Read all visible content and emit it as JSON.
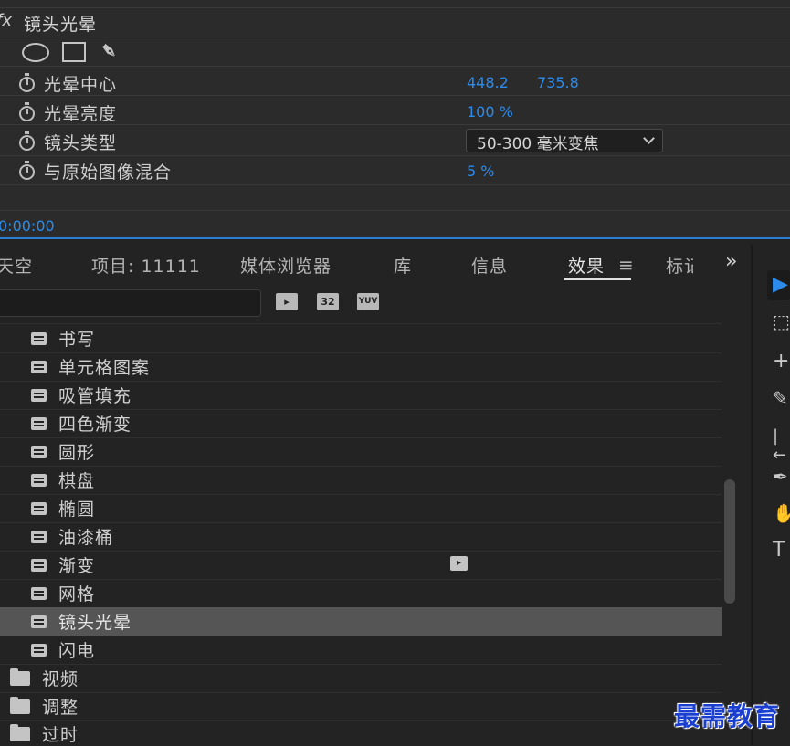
{
  "effect_controls": {
    "fx_badge": "fx",
    "effect_name": "镜头光晕",
    "mask_tools": [
      "ellipse-mask-icon",
      "rectangle-mask-icon",
      "pen-mask-icon"
    ],
    "params": [
      {
        "label": "光晕中心",
        "value_x": "448.2",
        "value_y": "735.8"
      },
      {
        "label": "光晕亮度",
        "value": "100 %"
      },
      {
        "label": "镜头类型",
        "dropdown": "50-300 毫米变焦"
      },
      {
        "label": "与原始图像混合",
        "value": "5 %"
      }
    ],
    "timecode": "0:00:00",
    "accent_color": "#2d8ceb"
  },
  "tabs": [
    {
      "label": "天空"
    },
    {
      "label": "项目: 11111"
    },
    {
      "label": "媒体浏览器"
    },
    {
      "label": "库"
    },
    {
      "label": "信息"
    },
    {
      "label": "效果",
      "active": true
    },
    {
      "label": "标记"
    }
  ],
  "tab_menu_icon": "≡",
  "overflow_icon": "»",
  "filter_buttons": [
    "accelerated-effects-icon",
    "32",
    "YUV"
  ],
  "effects_list": [
    {
      "label": "书写",
      "type": "effect"
    },
    {
      "label": "单元格图案",
      "type": "effect"
    },
    {
      "label": "吸管填充",
      "type": "effect"
    },
    {
      "label": "四色渐变",
      "type": "effect"
    },
    {
      "label": "圆形",
      "type": "effect"
    },
    {
      "label": "棋盘",
      "type": "effect"
    },
    {
      "label": "椭圆",
      "type": "effect"
    },
    {
      "label": "油漆桶",
      "type": "effect"
    },
    {
      "label": "渐变",
      "type": "effect",
      "accelerated": true
    },
    {
      "label": "网格",
      "type": "effect"
    },
    {
      "label": "镜头光晕",
      "type": "effect",
      "selected": true
    },
    {
      "label": "闪电",
      "type": "effect"
    },
    {
      "label": "视频",
      "type": "folder"
    },
    {
      "label": "调整",
      "type": "folder"
    },
    {
      "label": "过时",
      "type": "folder"
    }
  ],
  "tools": [
    "selection-tool-icon",
    "track-select-icon",
    "ripple-edit-icon",
    "razor-icon",
    "slip-icon",
    "pen-icon",
    "hand-icon",
    "type-icon"
  ],
  "tool_glyphs": [
    "▶",
    "⬚",
    "+",
    "✎",
    "|←",
    "✒",
    "✋",
    "T"
  ],
  "watermark": "最需教育"
}
